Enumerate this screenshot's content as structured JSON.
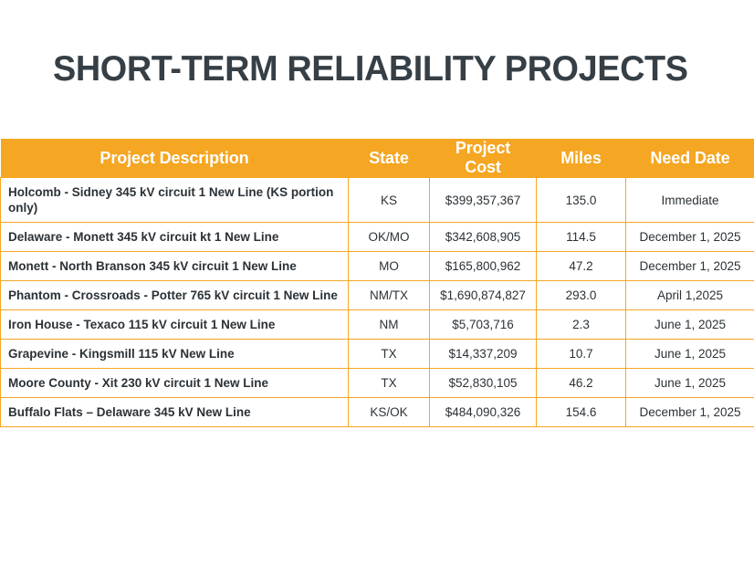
{
  "title": "SHORT-TERM RELIABILITY PROJECTS",
  "colors": {
    "accent_orange": "#F5A623",
    "title_text": "#363F45",
    "header_text": "#FFFFFF",
    "body_text": "#2B3237",
    "background": "#FFFFFF"
  },
  "table": {
    "headers": {
      "description": "Project Description",
      "state": "State",
      "cost": "Project Cost",
      "miles": "Miles",
      "need_date": "Need Date"
    },
    "rows": [
      {
        "description": "Holcomb - Sidney 345 kV circuit 1 New Line (KS portion only)",
        "state": "KS",
        "cost": "$399,357,367",
        "miles": "135.0",
        "need_date": "Immediate"
      },
      {
        "description": "Delaware - Monett 345 kV circuit kt 1 New Line",
        "state": "OK/MO",
        "cost": "$342,608,905",
        "miles": "114.5",
        "need_date": "December 1, 2025"
      },
      {
        "description": "Monett - North Branson 345 kV circuit 1 New Line",
        "state": "MO",
        "cost": "$165,800,962",
        "miles": "47.2",
        "need_date": "December 1, 2025"
      },
      {
        "description": "Phantom - Crossroads - Potter 765 kV circuit 1 New Line",
        "state": "NM/TX",
        "cost": "$1,690,874,827",
        "miles": "293.0",
        "need_date": "April 1,2025"
      },
      {
        "description": "Iron House - Texaco 115 kV circuit 1 New Line",
        "state": "NM",
        "cost": "$5,703,716",
        "miles": "2.3",
        "need_date": "June 1, 2025"
      },
      {
        "description": "Grapevine - Kingsmill 115 kV New Line",
        "state": "TX",
        "cost": "$14,337,209",
        "miles": "10.7",
        "need_date": "June 1, 2025"
      },
      {
        "description": "Moore County - Xit 230 kV circuit 1 New Line",
        "state": "TX",
        "cost": "$52,830,105",
        "miles": "46.2",
        "need_date": "June 1, 2025"
      },
      {
        "description": "Buffalo Flats – Delaware 345 kV New Line",
        "state": "KS/OK",
        "cost": "$484,090,326",
        "miles": "154.6",
        "need_date": "December 1, 2025"
      }
    ]
  }
}
